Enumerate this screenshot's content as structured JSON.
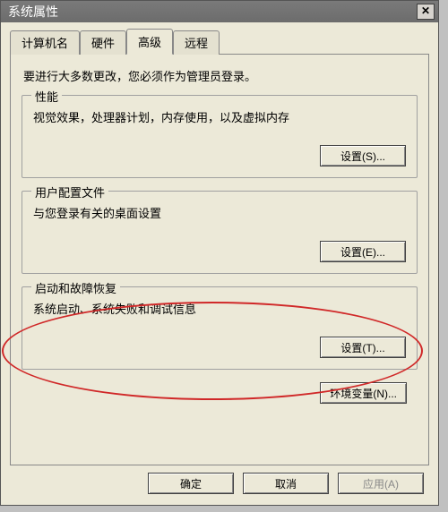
{
  "window": {
    "title": "系统属性"
  },
  "tabs": {
    "items": [
      {
        "label": "计算机名"
      },
      {
        "label": "硬件"
      },
      {
        "label": "高级"
      },
      {
        "label": "远程"
      }
    ],
    "activeIndex": 2
  },
  "panel": {
    "intro": "要进行大多数更改，您必须作为管理员登录。"
  },
  "groups": {
    "performance": {
      "legend": "性能",
      "desc": "视觉效果，处理器计划，内存使用，以及虚拟内存",
      "button": "设置(S)..."
    },
    "userProfiles": {
      "legend": "用户配置文件",
      "desc": "与您登录有关的桌面设置",
      "button": "设置(E)..."
    },
    "startupRecovery": {
      "legend": "启动和故障恢复",
      "desc": "系统启动、系统失败和调试信息",
      "button": "设置(T)..."
    }
  },
  "envVarsButton": "环境变量(N)...",
  "footer": {
    "ok": "确定",
    "cancel": "取消",
    "apply": "应用(A)"
  },
  "icons": {
    "close": "✕"
  }
}
